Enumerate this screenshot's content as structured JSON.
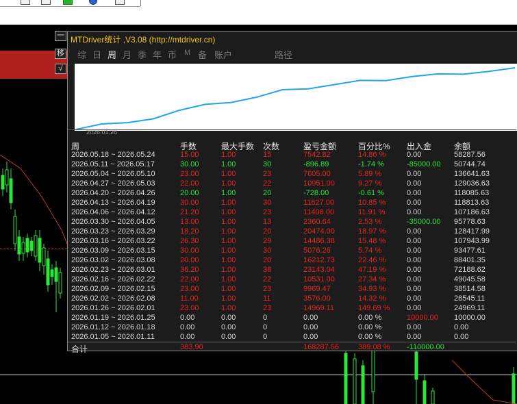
{
  "panel": {
    "title": "MTDriver统计 ,V3.08 (http://mtdriver.cn)",
    "side_buttons": [
      "一",
      "移",
      "√"
    ],
    "tabs": [
      "综",
      "日",
      "周",
      "月",
      "季",
      "年",
      "币",
      "M",
      "备",
      "账户",
      "路径"
    ],
    "active_tab": "周",
    "equity_start_date": "2026.01.26"
  },
  "table": {
    "headers": [
      "周",
      "手数",
      "最大手数",
      "次数",
      "盈亏金额",
      "百分比%",
      "出入金",
      "余额"
    ],
    "rows": [
      [
        "2026.05.18 ~ 2026.05.24",
        "15.00",
        "1.00",
        "15",
        "7542.82",
        "14.86 %",
        "0.00",
        "58287.56"
      ],
      [
        "2026.05.11 ~ 2026.05.17",
        "30.00",
        "1.00",
        "30",
        "-896.89",
        "-1.74 %",
        "-85000.00",
        "50744.74"
      ],
      [
        "2026.05.04 ~ 2026.05.10",
        "23.00",
        "1.00",
        "23",
        "7605.00",
        "5.89 %",
        "0.00",
        "136641.63"
      ],
      [
        "2026.04.27 ~ 2026.05.03",
        "22.00",
        "1.00",
        "22",
        "10951.00",
        "9.27 %",
        "0.00",
        "129036.63"
      ],
      [
        "2026.04.20 ~ 2026.04.26",
        "20.00",
        "1.00",
        "20",
        "-728.00",
        "-0.61 %",
        "0.00",
        "118085.63"
      ],
      [
        "2026.04.13 ~ 2026.04.19",
        "30.00",
        "1.00",
        "30",
        "11627.00",
        "10.85 %",
        "0.00",
        "118813.63"
      ],
      [
        "2026.04.06 ~ 2026.04.12",
        "21.20",
        "1.00",
        "23",
        "11408.00",
        "11.91 %",
        "0.00",
        "107186.63"
      ],
      [
        "2026.03.30 ~ 2026.04.05",
        "13.00",
        "1.00",
        "13",
        "2360.64",
        "2.53 %",
        "-35000.00",
        "95778.63"
      ],
      [
        "2026.03.23 ~ 2026.03.29",
        "18.20",
        "1.00",
        "20",
        "20474.00",
        "18.97 %",
        "0.00",
        "128417.99"
      ],
      [
        "2026.03.16 ~ 2026.03.22",
        "26.30",
        "1.00",
        "29",
        "14486.38",
        "15.48 %",
        "0.00",
        "107943.99"
      ],
      [
        "2026.03.09 ~ 2026.03.15",
        "30.00",
        "1.00",
        "30",
        "5076.26",
        "5.74 %",
        "0.00",
        "93477.61"
      ],
      [
        "2026.03.02 ~ 2026.03.08",
        "20.00",
        "1.00",
        "20",
        "16212.73",
        "22.46 %",
        "0.00",
        "88401.35"
      ],
      [
        "2026.02.23 ~ 2026.03.01",
        "36.20",
        "1.00",
        "38",
        "23143.04",
        "47.19 %",
        "0.00",
        "72188.62"
      ],
      [
        "2026.02.16 ~ 2026.02.22",
        "22.00",
        "1.00",
        "22",
        "10531.00",
        "27.34 %",
        "0.00",
        "49045.58"
      ],
      [
        "2026.02.09 ~ 2026.02.15",
        "23.00",
        "1.00",
        "23",
        "9969.47",
        "34.93 %",
        "0.00",
        "38514.58"
      ],
      [
        "2026.02.02 ~ 2026.02.08",
        "11.00",
        "1.00",
        "11",
        "3576.00",
        "14.32 %",
        "0.00",
        "28545.11"
      ],
      [
        "2026.01.26 ~ 2026.02.01",
        "23.00",
        "1.00",
        "23",
        "14969.11",
        "149.69 %",
        "0.00",
        "24969.11"
      ],
      [
        "2026.01.19 ~ 2026.01.25",
        "0.00",
        "0.00",
        "0",
        "0.00",
        "0.00 %",
        "10000.00",
        "10000.00"
      ],
      [
        "2026.01.12 ~ 2026.01.18",
        "0.00",
        "0.00",
        "0",
        "0.00",
        "0.00 %",
        "0.00",
        "0.00"
      ],
      [
        "2026.01.05 ~ 2026.01.11",
        "0.00",
        "0.00",
        "0",
        "0.00",
        "0.00 %",
        "0.00",
        "0.00"
      ]
    ],
    "row_colors": [
      "red",
      "green",
      "red",
      "red",
      "green",
      "red",
      "red",
      "red",
      "red",
      "red",
      "red",
      "red",
      "red",
      "red",
      "red",
      "red",
      "red",
      "white",
      "white",
      "white"
    ],
    "deposit_colors": [
      "white",
      "green",
      "white",
      "white",
      "white",
      "white",
      "white",
      "green",
      "white",
      "white",
      "white",
      "white",
      "white",
      "white",
      "white",
      "white",
      "white",
      "red",
      "white",
      "white"
    ],
    "total": {
      "label": "合计",
      "lots": "383.90",
      "profit": "168287.56",
      "percent": "389.08 %",
      "deposit": "-110000.00"
    }
  },
  "equity_curve": {
    "values": [
      0,
      14969,
      18545,
      29076,
      52219,
      68432,
      73508,
      87994,
      108468,
      110829,
      122237,
      133864,
      133136,
      144087,
      151692,
      150795,
      158338,
      168288
    ]
  },
  "colors": {
    "accent": "#f5c518",
    "positive": "#e8241d",
    "negative": "#2ee53a",
    "curve": "#1ea7e6"
  }
}
